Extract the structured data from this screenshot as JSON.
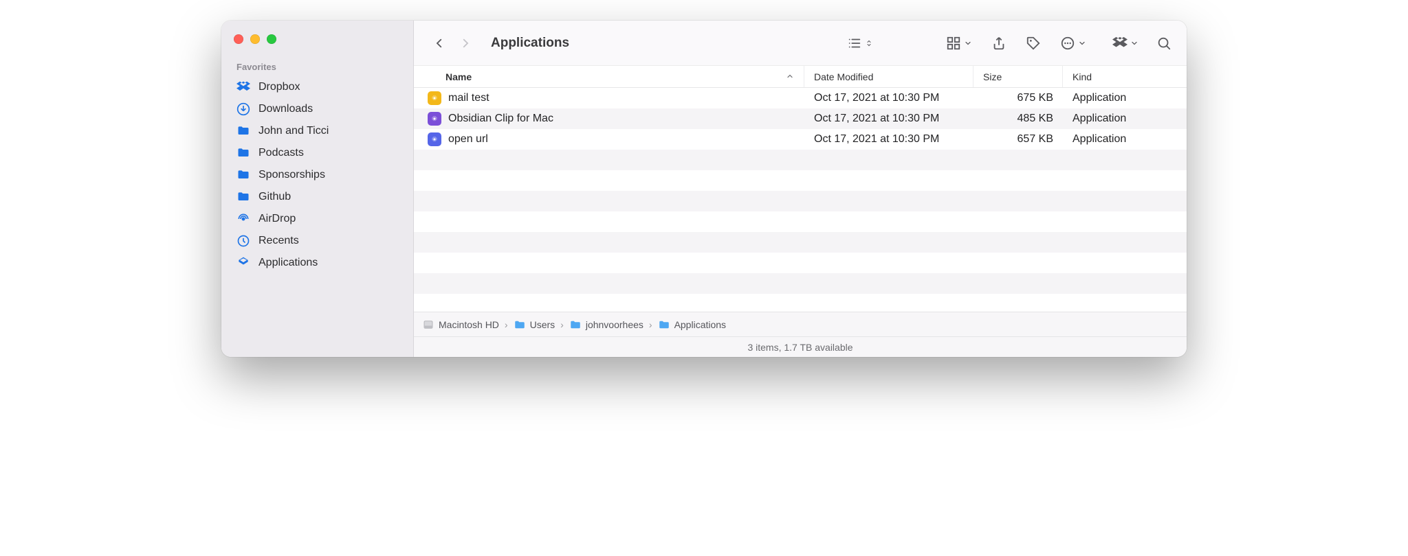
{
  "window": {
    "title": "Applications"
  },
  "sidebar": {
    "section": "Favorites",
    "items": [
      {
        "label": "Dropbox",
        "icon": "dropbox"
      },
      {
        "label": "Downloads",
        "icon": "download"
      },
      {
        "label": "John and Ticci",
        "icon": "folder"
      },
      {
        "label": "Podcasts",
        "icon": "folder"
      },
      {
        "label": "Sponsorships",
        "icon": "folder"
      },
      {
        "label": "Github",
        "icon": "folder"
      },
      {
        "label": "AirDrop",
        "icon": "airdrop"
      },
      {
        "label": "Recents",
        "icon": "recents"
      },
      {
        "label": "Applications",
        "icon": "applications"
      }
    ]
  },
  "columns": {
    "name": "Name",
    "date": "Date Modified",
    "size": "Size",
    "kind": "Kind"
  },
  "files": [
    {
      "name": "mail test",
      "date": "Oct 17, 2021 at 10:30 PM",
      "size": "675 KB",
      "kind": "Application",
      "color": "#f3b81a"
    },
    {
      "name": "Obsidian Clip for Mac",
      "date": "Oct 17, 2021 at 10:30 PM",
      "size": "485 KB",
      "kind": "Application",
      "color": "#7b4fd8"
    },
    {
      "name": "open url",
      "date": "Oct 17, 2021 at 10:30 PM",
      "size": "657 KB",
      "kind": "Application",
      "color": "#5565e8"
    }
  ],
  "path": [
    {
      "label": "Macintosh HD",
      "icon": "disk"
    },
    {
      "label": "Users",
      "icon": "folder"
    },
    {
      "label": "johnvoorhees",
      "icon": "folder"
    },
    {
      "label": "Applications",
      "icon": "folder"
    }
  ],
  "status": "3 items, 1.7 TB available"
}
